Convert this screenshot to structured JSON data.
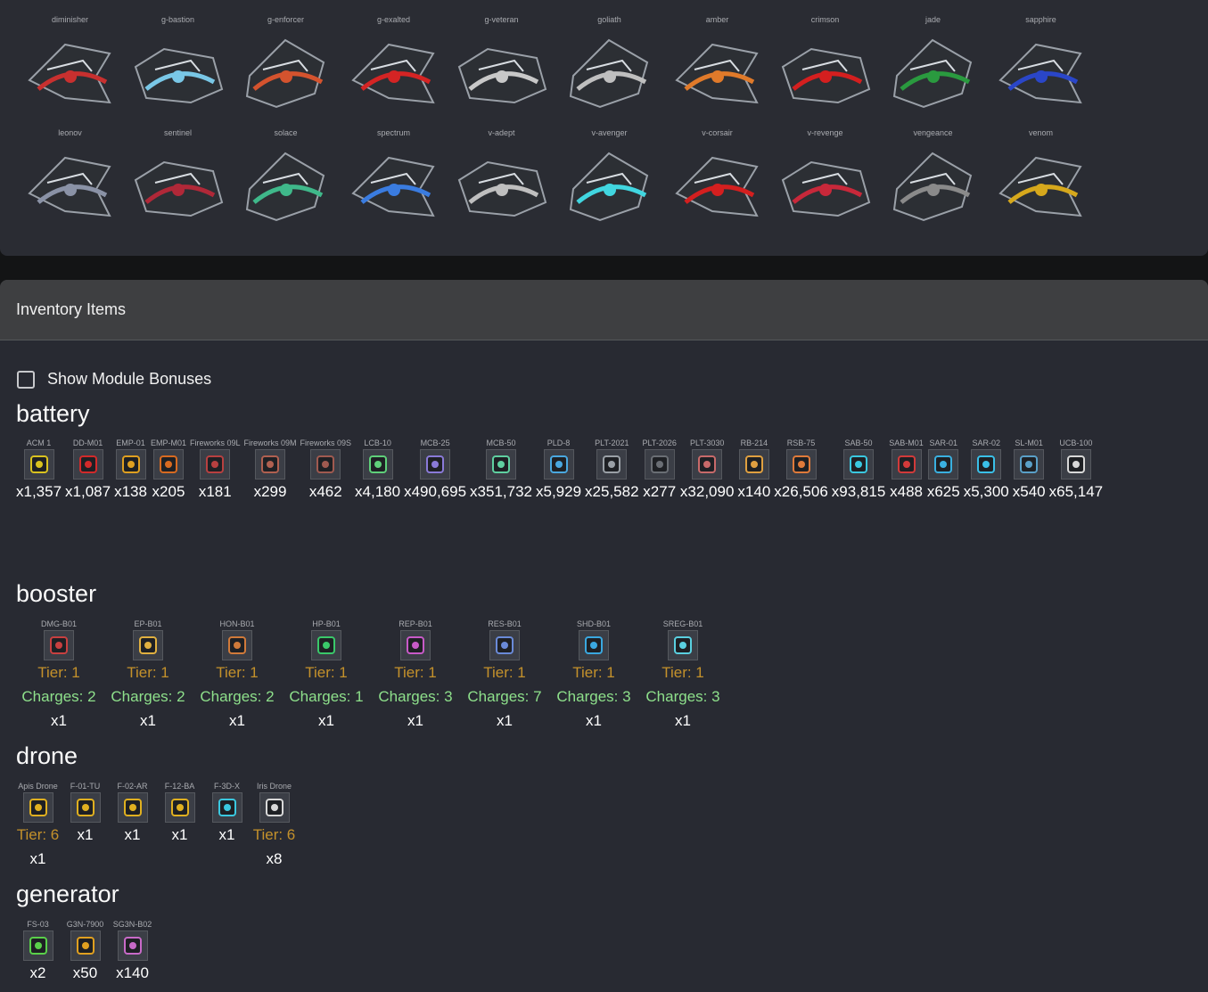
{
  "ships": {
    "row1": [
      {
        "name": "diminisher",
        "accent": "#c8302f",
        "icon": "ship-icon"
      },
      {
        "name": "g-bastion",
        "accent": "#79c7e6",
        "icon": "ship-icon"
      },
      {
        "name": "g-enforcer",
        "accent": "#d4532e",
        "icon": "ship-icon"
      },
      {
        "name": "g-exalted",
        "accent": "#d42424",
        "icon": "ship-icon"
      },
      {
        "name": "g-veteran",
        "accent": "#c8c8c8",
        "icon": "ship-icon"
      },
      {
        "name": "goliath",
        "accent": "#bfbfbf",
        "icon": "ship-icon"
      },
      {
        "name": "amber",
        "accent": "#e07a2a",
        "icon": "ship-icon"
      },
      {
        "name": "crimson",
        "accent": "#d41f1f",
        "icon": "ship-icon"
      },
      {
        "name": "jade",
        "accent": "#2a9a3f",
        "icon": "ship-icon"
      },
      {
        "name": "sapphire",
        "accent": "#2a46c8",
        "icon": "ship-icon"
      }
    ],
    "row2": [
      {
        "name": "leonov",
        "accent": "#8a92a6",
        "icon": "ship-icon"
      },
      {
        "name": "sentinel",
        "accent": "#b02838",
        "icon": "ship-icon"
      },
      {
        "name": "solace",
        "accent": "#3fb88a",
        "icon": "ship-icon"
      },
      {
        "name": "spectrum",
        "accent": "#3a7ce0",
        "icon": "ship-icon"
      },
      {
        "name": "v-adept",
        "accent": "#bfbfbf",
        "icon": "ship-icon"
      },
      {
        "name": "v-avenger",
        "accent": "#41d6e0",
        "icon": "ship-icon"
      },
      {
        "name": "v-corsair",
        "accent": "#d41f1f",
        "icon": "ship-icon"
      },
      {
        "name": "v-revenge",
        "accent": "#c8283a",
        "icon": "ship-icon"
      },
      {
        "name": "vengeance",
        "accent": "#8a8a8a",
        "icon": "ship-icon"
      },
      {
        "name": "venom",
        "accent": "#d6a81c",
        "icon": "ship-icon"
      }
    ]
  },
  "inventory": {
    "title": "Inventory Items",
    "show_module_bonuses_label": "Show Module Bonuses",
    "categories": {
      "battery": "battery",
      "booster": "booster",
      "drone": "drone",
      "generator": "generator"
    },
    "battery": [
      {
        "name": "ACM 1",
        "qty": "x1,357",
        "color": "#d9c21f"
      },
      {
        "name": "DD-M01",
        "qty": "x1,087",
        "color": "#d22a2a"
      },
      {
        "name": "EMP-01",
        "qty": "x138",
        "color": "#e0a020"
      },
      {
        "name": "EMP-M01",
        "qty": "x205",
        "color": "#d86a20"
      },
      {
        "name": "Fireworks 09L",
        "qty": "x181",
        "color": "#b84040"
      },
      {
        "name": "Fireworks 09M",
        "qty": "x299",
        "color": "#b06050"
      },
      {
        "name": "Fireworks 09S",
        "qty": "x462",
        "color": "#a05a50"
      },
      {
        "name": "LCB-10",
        "qty": "x4,180",
        "color": "#5fd07a"
      },
      {
        "name": "MCB-25",
        "qty": "x490,695",
        "color": "#8a7ad8"
      },
      {
        "name": "MCB-50",
        "qty": "x351,732",
        "color": "#5fd0a0"
      },
      {
        "name": "PLD-8",
        "qty": "x5,929",
        "color": "#4aa8e0"
      },
      {
        "name": "PLT-2021",
        "qty": "x25,582",
        "color": "#9aa0a6"
      },
      {
        "name": "PLT-2026",
        "qty": "x277",
        "color": "#6a6e74"
      },
      {
        "name": "PLT-3030",
        "qty": "x32,090",
        "color": "#c86a6a"
      },
      {
        "name": "RB-214",
        "qty": "x140",
        "color": "#e0a040"
      },
      {
        "name": "RSB-75",
        "qty": "x26,506",
        "color": "#e07a3a"
      },
      {
        "name": "SAB-50",
        "qty": "x93,815",
        "color": "#3ac8e0"
      },
      {
        "name": "SAB-M01",
        "qty": "x488",
        "color": "#d23a3a"
      },
      {
        "name": "SAR-01",
        "qty": "x625",
        "color": "#3ab0e0"
      },
      {
        "name": "SAR-02",
        "qty": "x5,300",
        "color": "#3ac0e8"
      },
      {
        "name": "SL-M01",
        "qty": "x540",
        "color": "#5aa0c8"
      },
      {
        "name": "UCB-100",
        "qty": "x65,147",
        "color": "#d8d8d8"
      }
    ],
    "booster": [
      {
        "name": "DMG-B01",
        "tier": "Tier: 1",
        "charges": "Charges: 2",
        "qty": "x1",
        "color": "#c84040"
      },
      {
        "name": "EP-B01",
        "tier": "Tier: 1",
        "charges": "Charges: 2",
        "qty": "x1",
        "color": "#e0b040"
      },
      {
        "name": "HON-B01",
        "tier": "Tier: 1",
        "charges": "Charges: 2",
        "qty": "x1",
        "color": "#d07a3a"
      },
      {
        "name": "HP-B01",
        "tier": "Tier: 1",
        "charges": "Charges: 1",
        "qty": "x1",
        "color": "#3ac86a"
      },
      {
        "name": "REP-B01",
        "tier": "Tier: 1",
        "charges": "Charges: 3",
        "qty": "x1",
        "color": "#c85ac8"
      },
      {
        "name": "RES-B01",
        "tier": "Tier: 1",
        "charges": "Charges: 7",
        "qty": "x1",
        "color": "#6a8ad8"
      },
      {
        "name": "SHD-B01",
        "tier": "Tier: 1",
        "charges": "Charges: 3",
        "qty": "x1",
        "color": "#3aa8e0"
      },
      {
        "name": "SREG-B01",
        "tier": "Tier: 1",
        "charges": "Charges: 3",
        "qty": "x1",
        "color": "#5ad0e0"
      }
    ],
    "drone": [
      {
        "name": "Apis Drone",
        "tier": "Tier: 6",
        "qty": "x1",
        "color": "#e0b020"
      },
      {
        "name": "F-01-TU",
        "qty": "x1",
        "color": "#e0b020"
      },
      {
        "name": "F-02-AR",
        "qty": "x1",
        "color": "#e0b020"
      },
      {
        "name": "F-12-BA",
        "qty": "x1",
        "color": "#e0b020"
      },
      {
        "name": "F-3D-X",
        "qty": "x1",
        "color": "#3ac8e0"
      },
      {
        "name": "Iris Drone",
        "tier": "Tier: 6",
        "qty": "x8",
        "color": "#d8d8d8"
      }
    ],
    "generator": [
      {
        "name": "FS-03",
        "qty": "x2",
        "color": "#5ad04a"
      },
      {
        "name": "G3N-7900",
        "qty": "x50",
        "color": "#e0a020"
      },
      {
        "name": "SG3N-B02",
        "qty": "x140",
        "color": "#c86ac8"
      }
    ]
  }
}
